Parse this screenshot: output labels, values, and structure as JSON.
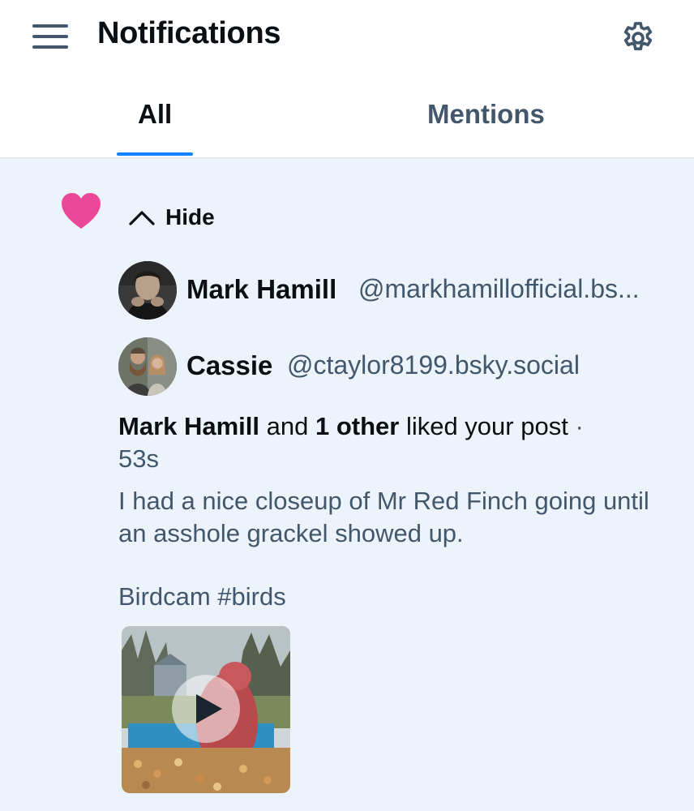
{
  "header": {
    "title": "Notifications",
    "menu_icon": "hamburger-menu-icon",
    "settings_icon": "gear-icon"
  },
  "tabs": [
    {
      "label": "All",
      "selected": true
    },
    {
      "label": "Mentions",
      "selected": false
    }
  ],
  "colors": {
    "accent": "#1083fe",
    "heart": "#ec4899",
    "muted_text": "#42576c",
    "notification_bg": "#edf3fb"
  },
  "notification": {
    "type_icon": "heart-icon",
    "toggle_label": "Hide",
    "toggle_icon": "chevron-up-icon",
    "users": [
      {
        "name": "Mark Hamill",
        "handle": "@markhamillofficial.bs..."
      },
      {
        "name": "Cassie",
        "handle": "@ctaylor8199.bsky.social"
      }
    ],
    "summary": {
      "actor": "Mark Hamill",
      "conjunction": " and ",
      "others": "1 other",
      "action": " liked your post",
      "separator": " · ",
      "time": "53s"
    },
    "post": {
      "text": "I had a nice closeup of Mr Red Finch going until an asshole grackel showed up.",
      "caption": "Birdcam #birds",
      "media_icon": "play-icon"
    }
  }
}
